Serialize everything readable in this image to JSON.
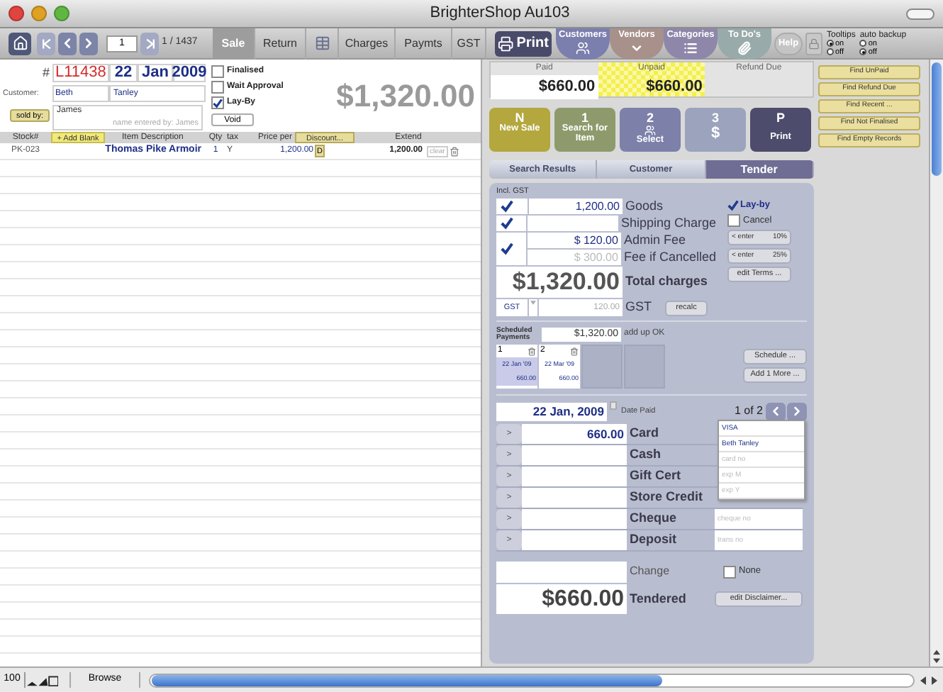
{
  "window": {
    "title": "BrighterShop Au103"
  },
  "toolbar": {
    "record": "1",
    "record_count": "1 / 1437",
    "tabs": [
      {
        "kind": "text",
        "label": "Sale",
        "selected": true
      },
      {
        "kind": "text",
        "label": "Return",
        "selected": false
      },
      {
        "kind": "grid",
        "selected": false
      },
      {
        "kind": "text",
        "label": "Charges",
        "selected": false
      },
      {
        "kind": "text",
        "label": "Paymts",
        "selected": false
      },
      {
        "kind": "text",
        "label": "GST",
        "selected": false
      }
    ],
    "print": "Print",
    "modules": [
      {
        "label": "Customers",
        "kind": "people",
        "color": "#7b7fae"
      },
      {
        "label": "Vendors",
        "kind": "chevron",
        "color": "#a8908b"
      },
      {
        "label": "Categories",
        "kind": "list",
        "color": "#8e87a9"
      },
      {
        "label": "To Do's",
        "kind": "clip",
        "color": "#98aaa9"
      }
    ],
    "help": "Help",
    "toggles": [
      {
        "label": "Tooltips",
        "options": [
          {
            "label": "on",
            "selected": true
          },
          {
            "label": "off",
            "selected": false
          }
        ]
      },
      {
        "label": "auto backup",
        "options": [
          {
            "label": "on",
            "selected": false
          },
          {
            "label": "off",
            "selected": true
          }
        ]
      }
    ]
  },
  "sale": {
    "number_label": "#",
    "number": "L11438",
    "day": "22",
    "month": "Jan",
    "year": "2009",
    "customer_label": "Customer:",
    "first_name": "Beth",
    "last_name": "Tanley",
    "sold_by_button": "sold by:",
    "sold_by": "James",
    "entered_by": "name entered by: James",
    "flags": [
      {
        "label": "Finalised",
        "checked": false
      },
      {
        "label": "Wait Approval",
        "checked": false
      },
      {
        "label": "Lay-By",
        "checked": true
      }
    ],
    "void_button": "Void",
    "total": "$1,320.00"
  },
  "items": {
    "header": {
      "stock": "Stock#",
      "add_blank": "+ Add Blank",
      "description": "Item Description",
      "qty": "Qty",
      "tax": "tax",
      "price": "Price per",
      "discount": "Discount...",
      "extend": "Extend"
    },
    "rows": [
      {
        "stock": "PK-023",
        "description": "Thomas Pike Armoir",
        "qty": "1",
        "tax": "Y",
        "price": "1,200.00",
        "discount": "D",
        "extend": "1,200.00",
        "clear": "clear"
      }
    ]
  },
  "balance": {
    "paid_label": "Paid",
    "paid": "$660.00",
    "unpaid_label": "Unpaid",
    "unpaid": "$660.00",
    "refund_label": "Refund Due"
  },
  "find_buttons": [
    "Find UnPaid",
    "Find Refund Due",
    "Find Recent ...",
    "Find Not Finalised",
    "Find Empty Records"
  ],
  "steps": [
    {
      "key": "N",
      "label": "New Sale",
      "kind": "plain",
      "color": "#b3a73e"
    },
    {
      "key": "1",
      "label": "Search for Item",
      "kind": "plain",
      "color": "#8e9a6c"
    },
    {
      "key": "2",
      "label": "Select",
      "kind": "people",
      "color": "#7d80a9"
    },
    {
      "key": "3",
      "label": "$",
      "kind": "big",
      "color": "#9ba3bd"
    },
    {
      "key": "P",
      "label": "Print",
      "kind": "plain",
      "color": "#4e4c6c"
    }
  ],
  "panel_tabs": [
    {
      "label": "Search Results",
      "selected": false
    },
    {
      "label": "Customer",
      "selected": false
    },
    {
      "label": "Tender",
      "selected": true
    }
  ],
  "tender": {
    "incl_label": "Incl. GST",
    "charges": [
      {
        "checked": true,
        "value": "1,200.00",
        "label": "Goods"
      },
      {
        "checked": true,
        "label": "Shipping Charge"
      }
    ],
    "admin": {
      "checked": true,
      "value": "$ 120.00",
      "label": "Admin Fee",
      "cancel_value": "$ 300.00",
      "cancel_label": "Fee if Cancelled"
    },
    "layby": {
      "label": "Lay-by",
      "checked": true
    },
    "cancel": {
      "label": "Cancel",
      "checked": false
    },
    "enter_buttons": [
      {
        "label": "< enter",
        "pct": "10%"
      },
      {
        "label": "< enter",
        "pct": "25%"
      }
    ],
    "edit_terms": "edit Terms ...",
    "total": "$1,320.00",
    "total_label": "Total charges",
    "gst_code": "GST",
    "gst_value": "120.00",
    "gst_label": "GST",
    "recalc": "recalc",
    "scheduled_label": "Scheduled Payments",
    "scheduled_total": "$1,320.00",
    "scheduled_status": "add up OK",
    "schedule": [
      {
        "number": "1",
        "date": "22 Jan '09",
        "amount": "660.00",
        "selected": true
      },
      {
        "number": "2",
        "date": "22 Mar '09",
        "amount": "660.00",
        "selected": false
      }
    ],
    "schedule_button": "Schedule ...",
    "add_more": "Add 1 More ...",
    "date_paid": "22 Jan, 2009",
    "date_paid_label": "Date Paid",
    "pager": "1 of 2",
    "methods": [
      {
        "arrow": ">",
        "value": "660.00",
        "label": "Card"
      },
      {
        "arrow": ">",
        "label": "Cash"
      },
      {
        "arrow": ">",
        "label": "Gift Cert"
      },
      {
        "arrow": ">",
        "label": "Store Credit"
      },
      {
        "arrow": ">",
        "label": "Cheque",
        "placeholder": "cheque no"
      },
      {
        "arrow": ">",
        "label": "Deposit",
        "placeholder": "trans no"
      }
    ],
    "card_fields": [
      {
        "value": "VISA"
      },
      {
        "value": "Beth Tanley"
      },
      {
        "placeholder": "card no"
      },
      {
        "placeholder": "exp M"
      },
      {
        "placeholder": "exp Y"
      }
    ],
    "change_label": "Change",
    "none": {
      "label": "None",
      "checked": false
    },
    "tendered": "$660.00",
    "tendered_label": "Tendered",
    "disclaimer": "edit Disclaimer..."
  },
  "status_bar": {
    "zoom": "100",
    "mode": "Browse"
  }
}
